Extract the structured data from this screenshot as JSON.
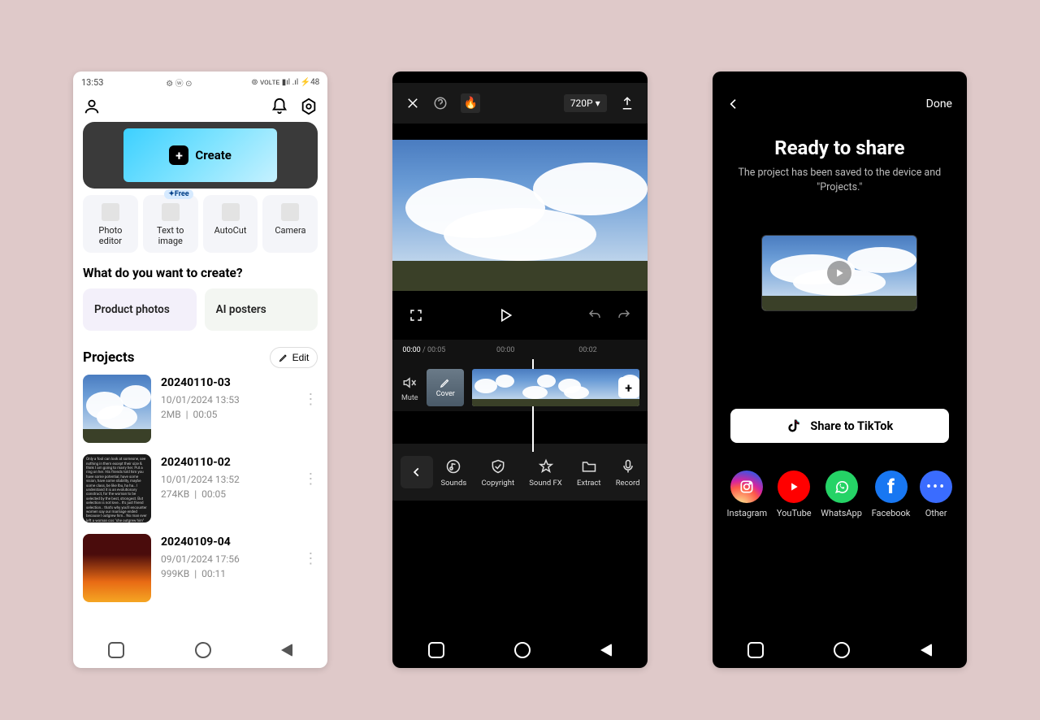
{
  "screen1": {
    "status_time": "13:53",
    "status_right": "⊚ ᴠᴏʟᴛᴇ ▮ıl .ıl ⚡48",
    "create_label": "Create",
    "tools": [
      {
        "label": "Photo editor",
        "badge": ""
      },
      {
        "label": "Text to image",
        "badge": "✦Free"
      },
      {
        "label": "AutoCut",
        "badge": ""
      },
      {
        "label": "Camera",
        "badge": ""
      }
    ],
    "create_heading": "What do you want to create?",
    "cats": [
      "Product photos",
      "AI posters"
    ],
    "projects_heading": "Projects",
    "edit_label": "Edit",
    "projects": [
      {
        "name": "20240110-03",
        "date": "10/01/2024 13:53",
        "size": "2MB",
        "dur": "00:05"
      },
      {
        "name": "20240110-02",
        "date": "10/01/2024 13:52",
        "size": "274KB",
        "dur": "00:05"
      },
      {
        "name": "20240109-04",
        "date": "09/01/2024 17:56",
        "size": "999KB",
        "dur": "00:11"
      }
    ]
  },
  "screen2": {
    "resolution": "720P",
    "current_time": "00:00",
    "total_time": "00:05",
    "marks": [
      "00:00",
      "00:02"
    ],
    "mute_label": "Mute",
    "cover_label": "Cover",
    "toolbar": [
      "Sounds",
      "Copyright",
      "Sound FX",
      "Extract",
      "Record"
    ]
  },
  "screen3": {
    "done_label": "Done",
    "title": "Ready to share",
    "subtitle": "The project has been saved to the device and \"Projects.\"",
    "share_label": "Share to TikTok",
    "socials": [
      "Instagram",
      "YouTube",
      "WhatsApp",
      "Facebook",
      "Other"
    ]
  }
}
